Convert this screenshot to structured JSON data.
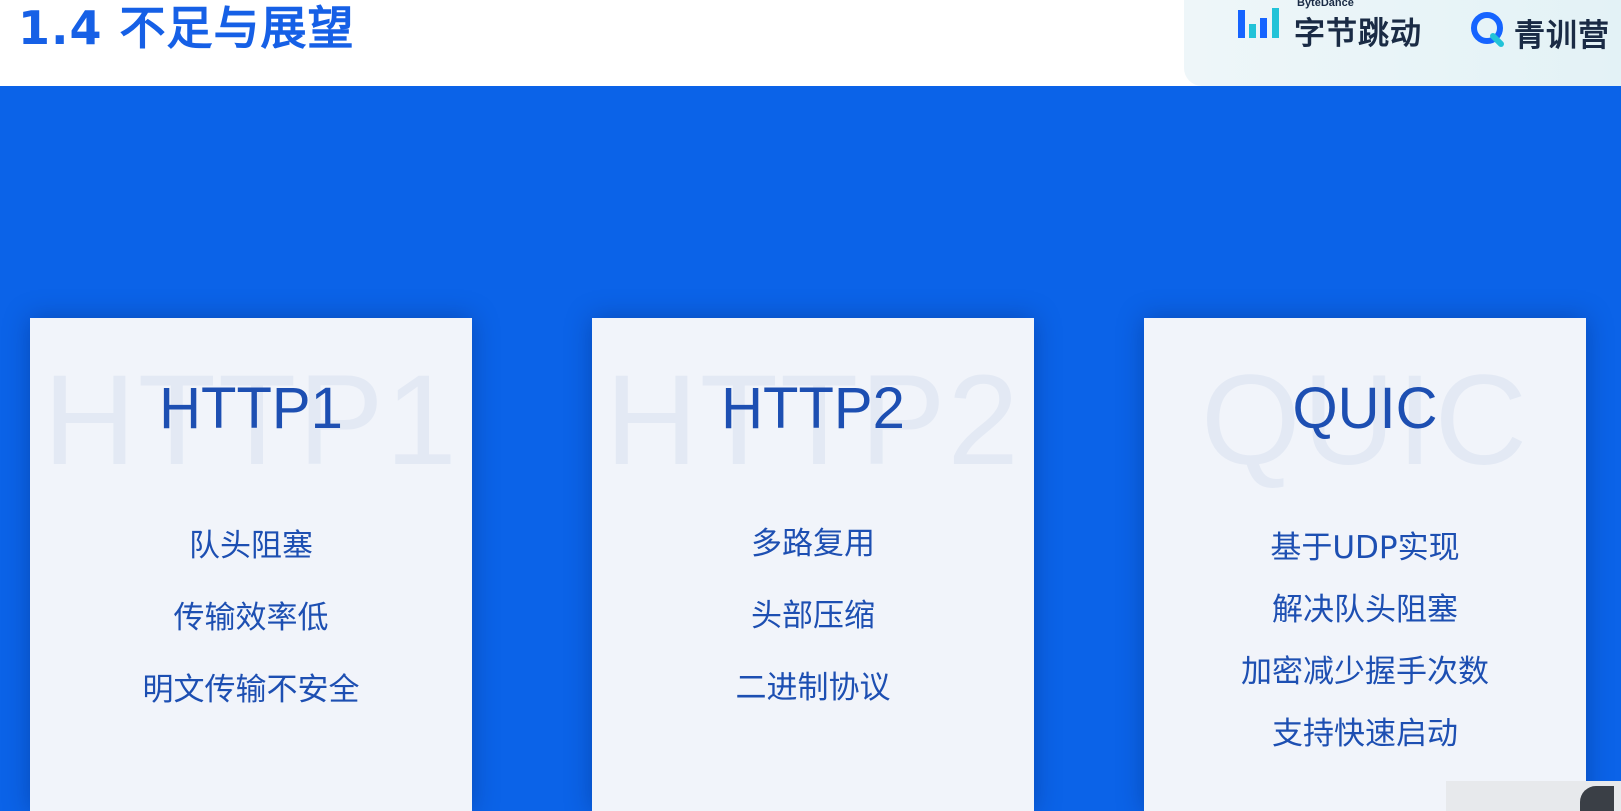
{
  "slide": {
    "title": "1.4  不足与展望"
  },
  "brand": {
    "bytedance_sub": "ByteDance",
    "bytedance_name": "字节跳动",
    "qingxun_name": "青训营"
  },
  "cards": [
    {
      "watermark": "HTTP1",
      "heading": "HTTP1",
      "features": [
        "队头阻塞",
        "传输效率低",
        "明文传输不安全"
      ]
    },
    {
      "watermark": "HTTP2",
      "heading": "HTTP2",
      "features": [
        "多路复用",
        "头部压缩",
        "二进制协议"
      ]
    },
    {
      "watermark": "QUIC",
      "heading": "QUIC",
      "features": [
        "基于UDP实现",
        "解决队头阻塞",
        "加密减少握手次数",
        "支持快速启动"
      ]
    }
  ],
  "colors": {
    "background": "#0b63e8",
    "title": "#1660e6",
    "card": "#f1f4fa",
    "card_text": "#1d4fb2",
    "logo_cyan": "#22c3d8",
    "logo_blue": "#1664ff"
  }
}
